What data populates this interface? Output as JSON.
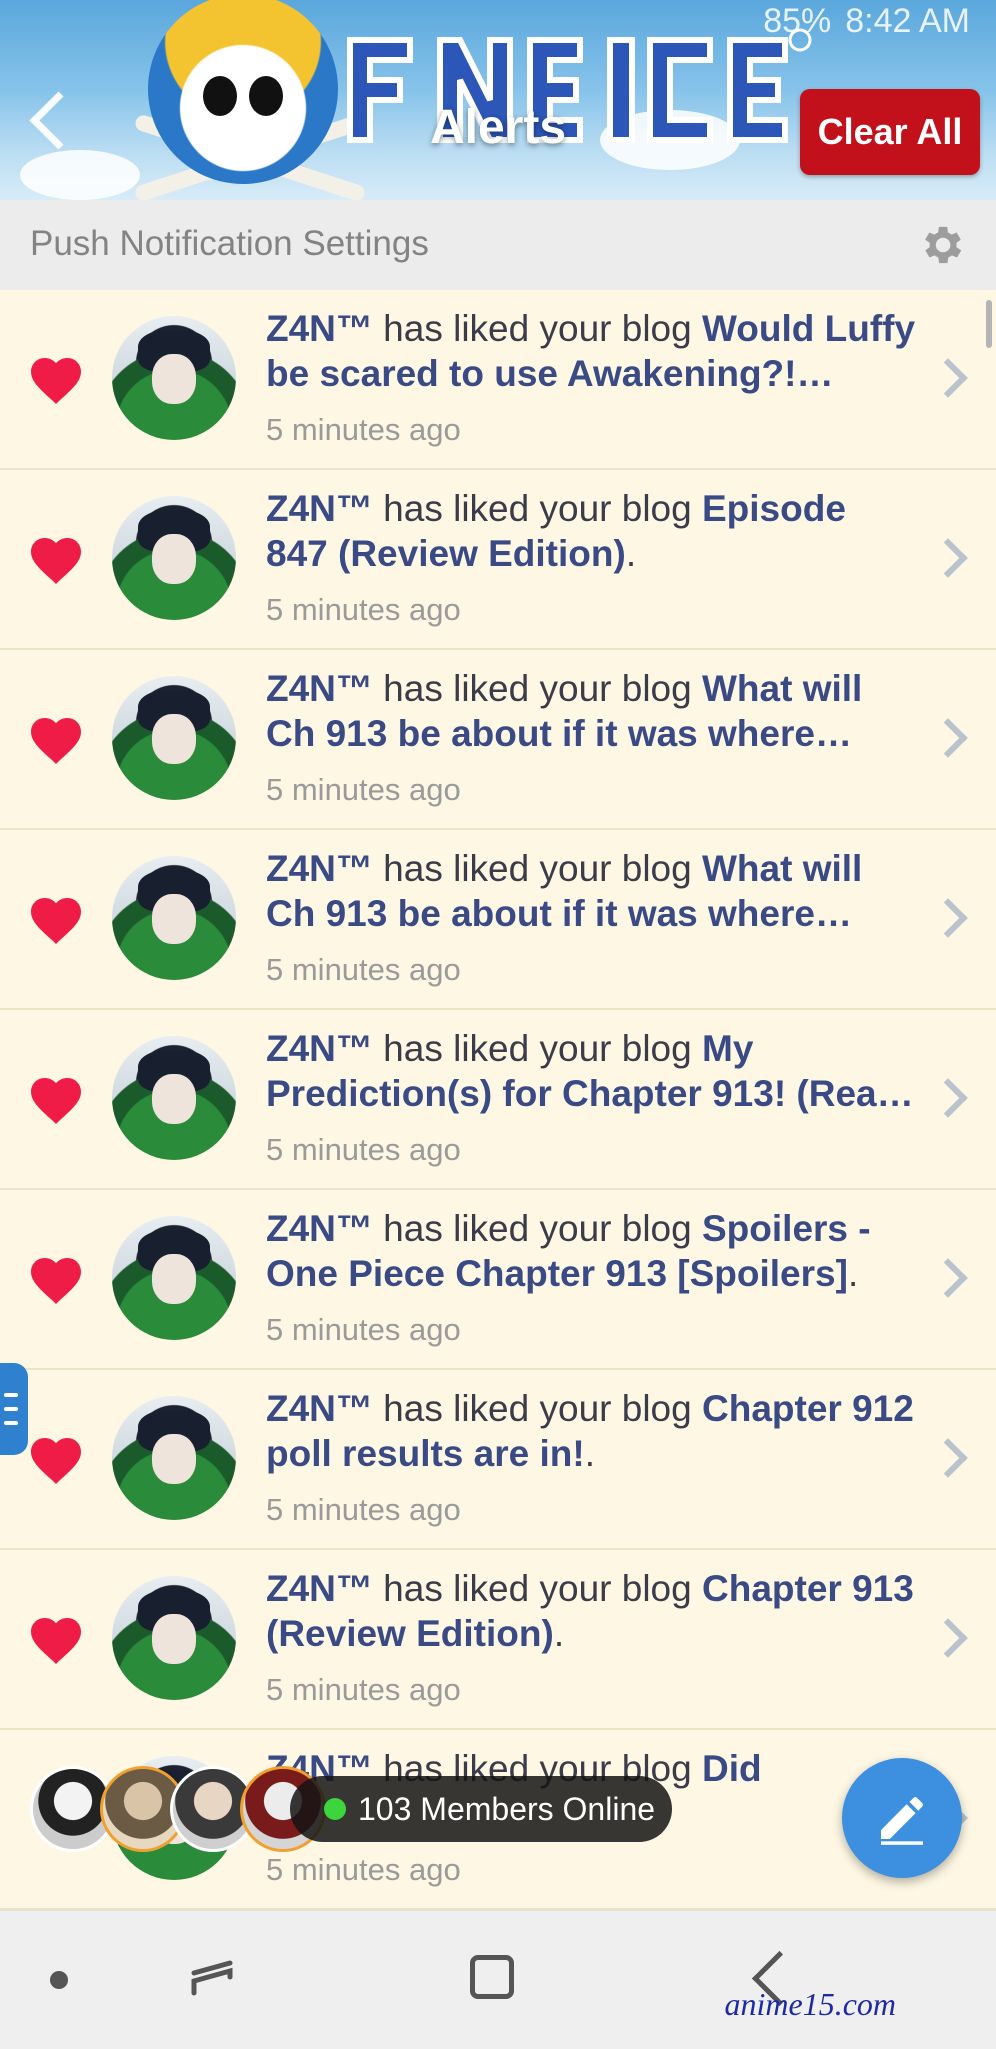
{
  "status_bar": {
    "battery": "85%",
    "time": "8:42 AM"
  },
  "header": {
    "title": "Alerts",
    "clear_all": "Clear All",
    "brand_logo_text": "ONE PIECE"
  },
  "settings": {
    "label": "Push Notification Settings"
  },
  "notifications": [
    {
      "user": "Z4N™",
      "action": " has liked your blog ",
      "blog": "Would Luffy be scared to use Awakening?!…",
      "suffix": "",
      "time": "5 minutes ago"
    },
    {
      "user": "Z4N™",
      "action": " has liked your blog ",
      "blog": "Episode 847 (Review Edition)",
      "suffix": ".",
      "time": "5 minutes ago"
    },
    {
      "user": "Z4N™",
      "action": " has liked your blog ",
      "blog": "What will Ch 913 be about if it was where…",
      "suffix": "",
      "time": "5 minutes ago"
    },
    {
      "user": "Z4N™",
      "action": " has liked your blog ",
      "blog": "What will Ch 913 be about if it was where…",
      "suffix": "",
      "time": "5 minutes ago"
    },
    {
      "user": "Z4N™",
      "action": " has liked your blog ",
      "blog": "My Prediction(s) for Chapter 913! (Rea…",
      "suffix": "",
      "time": "5 minutes ago"
    },
    {
      "user": "Z4N™",
      "action": " has liked your blog ",
      "blog": "Spoilers - One Piece Chapter 913 [Spoilers]",
      "suffix": ".",
      "time": "5 minutes ago"
    },
    {
      "user": "Z4N™",
      "action": " has liked your blog ",
      "blog": "Chapter 912 poll results are in!",
      "suffix": ".",
      "time": "5 minutes ago"
    },
    {
      "user": "Z4N™",
      "action": " has liked your blog ",
      "blog": "Chapter 913 (Review Edition)",
      "suffix": ".",
      "time": "5 minutes ago"
    },
    {
      "user": "Z4N™",
      "action": " has liked your blog ",
      "blog": "Did",
      "suffix": "",
      "time": "5 minutes ago"
    }
  ],
  "online": {
    "label": "103 Members Online"
  },
  "watermark": "anime15.com"
}
